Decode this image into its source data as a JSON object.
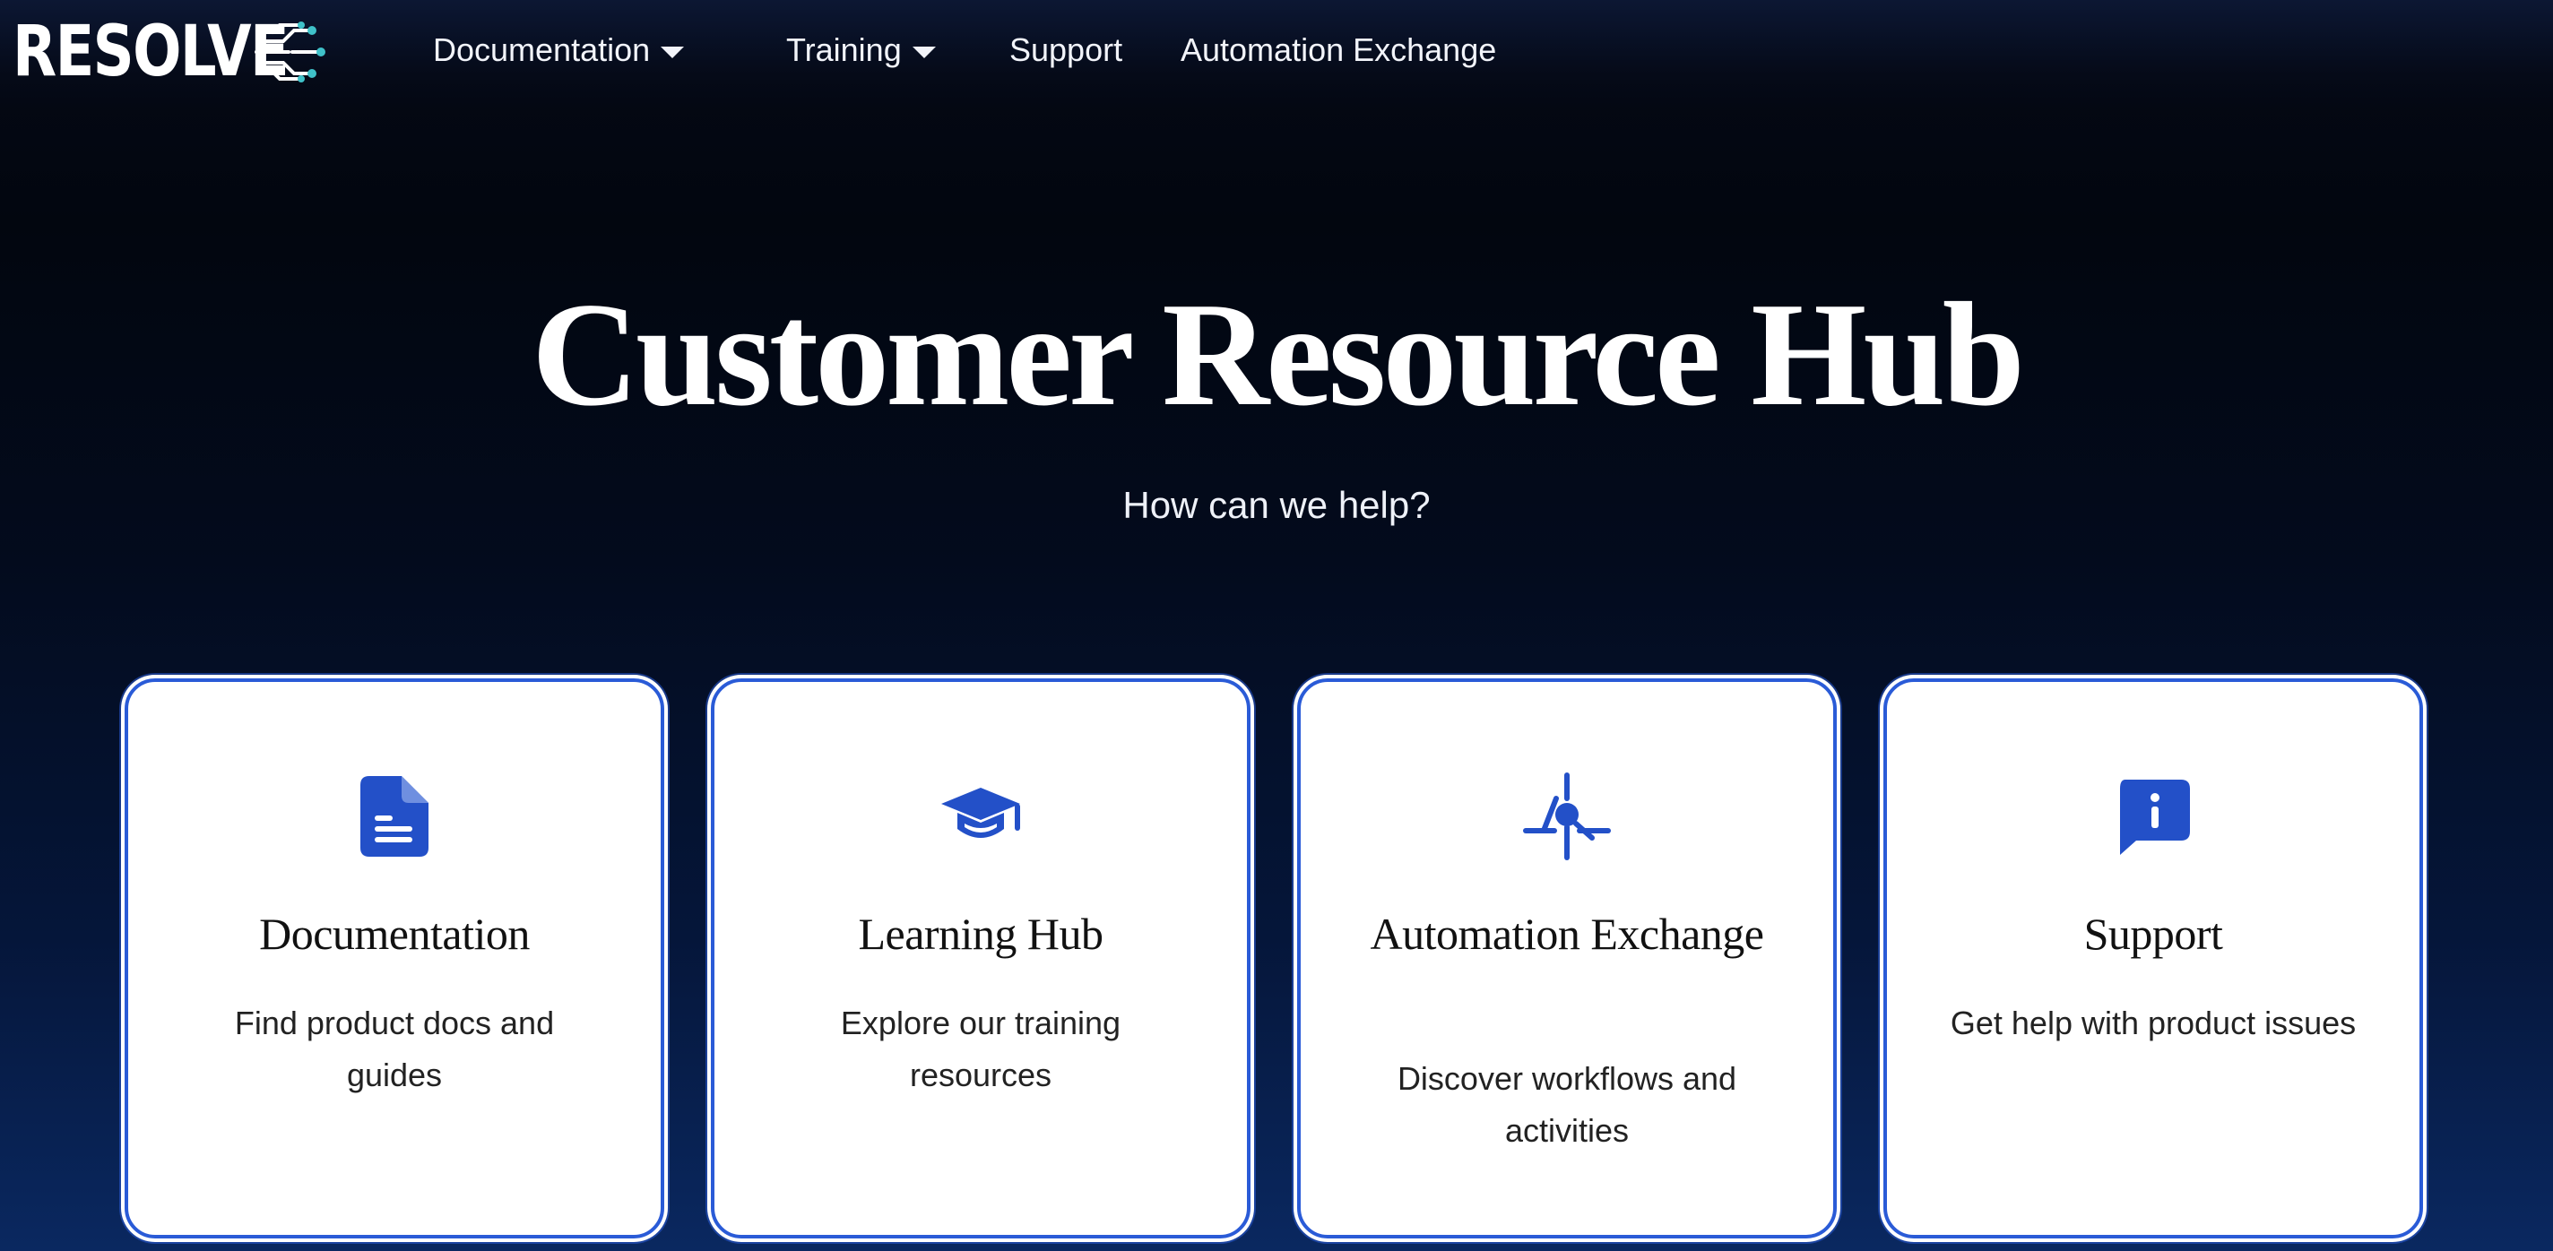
{
  "brand": {
    "logo_text": "RESOLVE",
    "accent_color": "#3fc1c9"
  },
  "nav": {
    "items": [
      {
        "label": "Documentation",
        "dropdown": true
      },
      {
        "label": "Training",
        "dropdown": true
      },
      {
        "label": "Support",
        "dropdown": false
      },
      {
        "label": "Automation Exchange",
        "dropdown": false
      }
    ]
  },
  "hero": {
    "title": "Customer Resource Hub",
    "subtitle": "How can we help?"
  },
  "cards": [
    {
      "icon": "document-icon",
      "title": "Documentation",
      "description": "Find product docs and guides"
    },
    {
      "icon": "graduation-cap-icon",
      "title": "Learning Hub",
      "description": "Explore our training resources"
    },
    {
      "icon": "automation-icon",
      "title": "Automation Exchange",
      "description": "Discover workflows and activities"
    },
    {
      "icon": "info-chat-icon",
      "title": "Support",
      "description": "Get help with product issues"
    }
  ],
  "colors": {
    "card_icon": "#2350c8",
    "card_border": "#2a5bd7"
  }
}
